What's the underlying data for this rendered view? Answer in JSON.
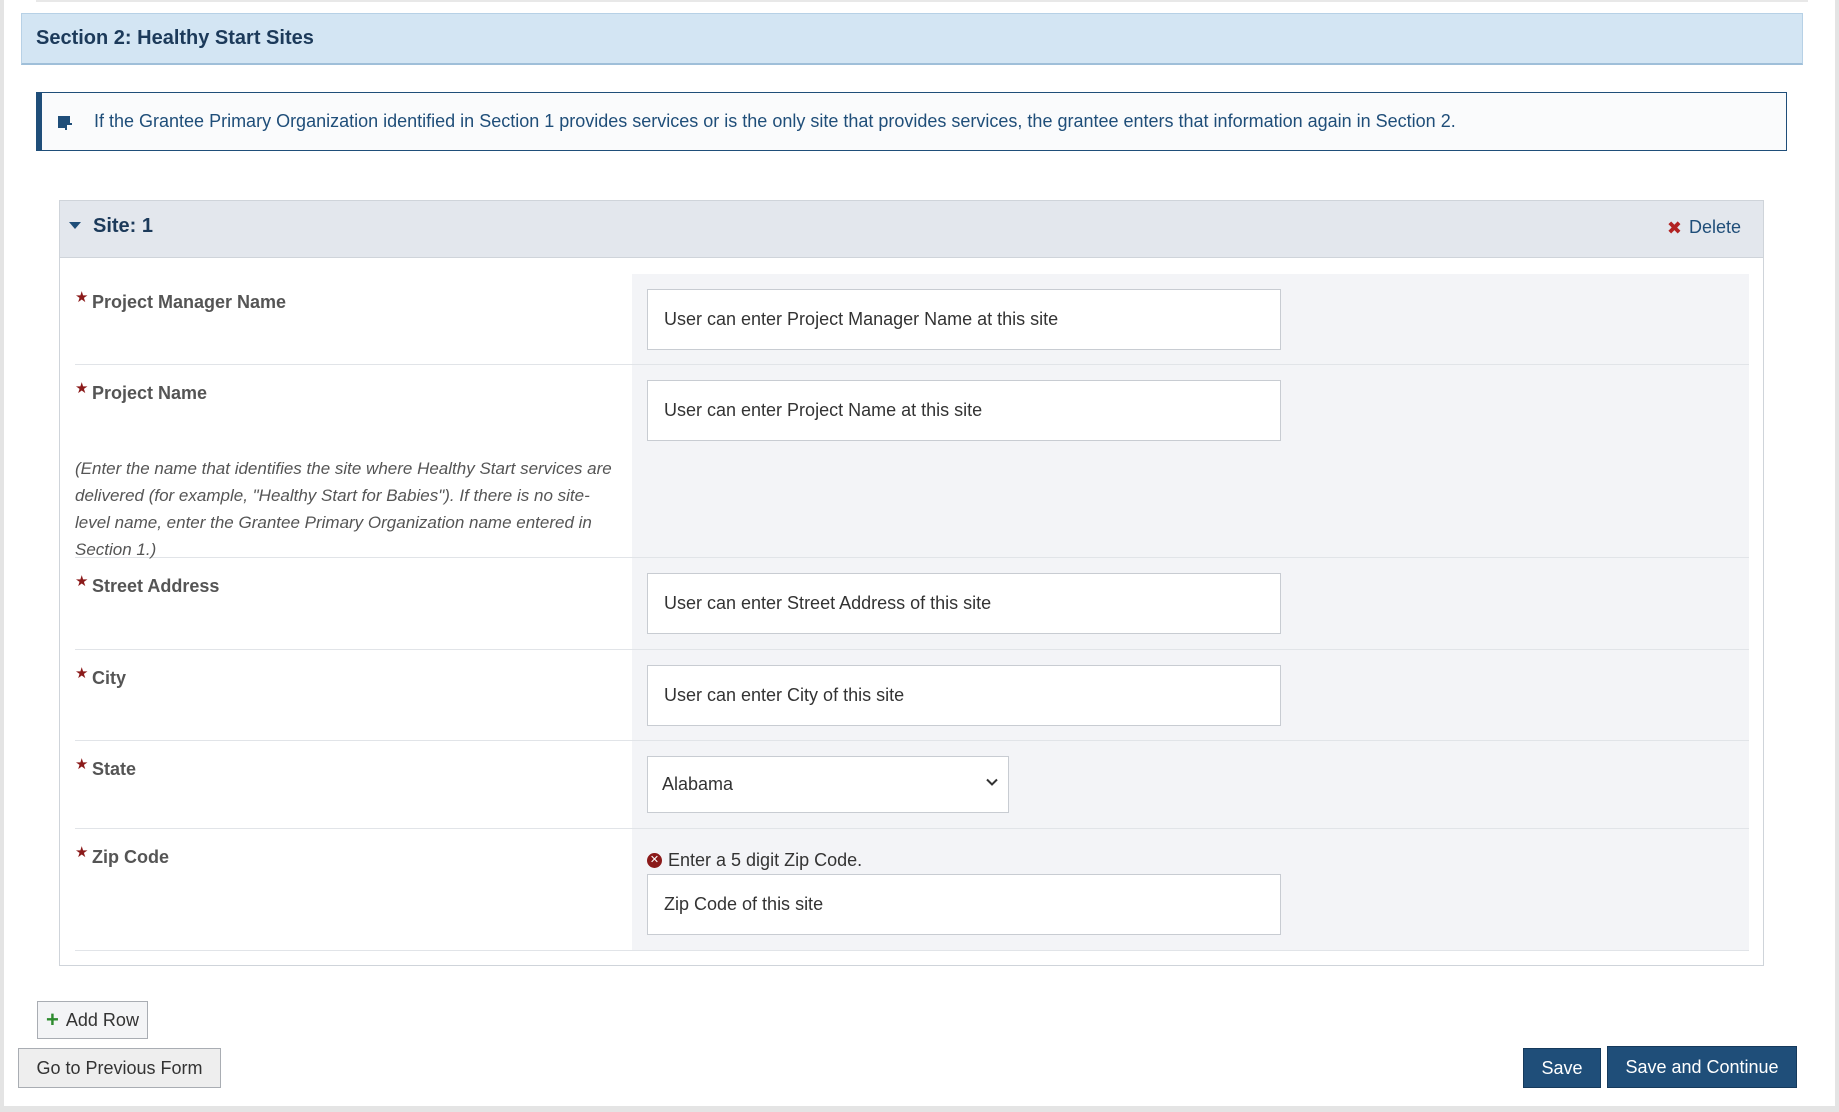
{
  "section": {
    "title": "Section 2: Healthy Start Sites"
  },
  "info": {
    "icon": "info-square-icon",
    "text": "If the Grantee Primary Organization identified in Section 1 provides services or is the only site that provides services, the grantee enters that information again in Section 2."
  },
  "site": {
    "title": "Site: 1",
    "delete_label": "Delete",
    "fields": {
      "project_manager_name": {
        "label": "Project Manager Name",
        "placeholder": "User can enter Project Manager Name at this site"
      },
      "project_name": {
        "label": "Project Name",
        "helper": "(Enter the name that identifies the site where Healthy Start services are delivered (for example, \"Healthy Start for Babies\"). If there is no site-level name, enter the Grantee Primary Organization name entered in Section 1.)",
        "placeholder": "User can enter Project Name at this site"
      },
      "street_address": {
        "label": "Street Address",
        "placeholder": "User can enter Street Address of this site"
      },
      "city": {
        "label": "City",
        "placeholder": "User can enter City of this site"
      },
      "state": {
        "label": "State",
        "selected": "Alabama"
      },
      "zip_code": {
        "label": "Zip Code",
        "error": "Enter a 5 digit Zip Code.",
        "placeholder": "Zip Code of this site"
      }
    }
  },
  "buttons": {
    "add_row": "Add Row",
    "previous": "Go to Previous Form",
    "save": "Save",
    "save_continue": "Save and Continue"
  },
  "colors": {
    "primary": "#1f4e79",
    "header_bg": "#d3e5f3",
    "required": "#8b1a1a",
    "add_icon": "#2e8b2e"
  }
}
